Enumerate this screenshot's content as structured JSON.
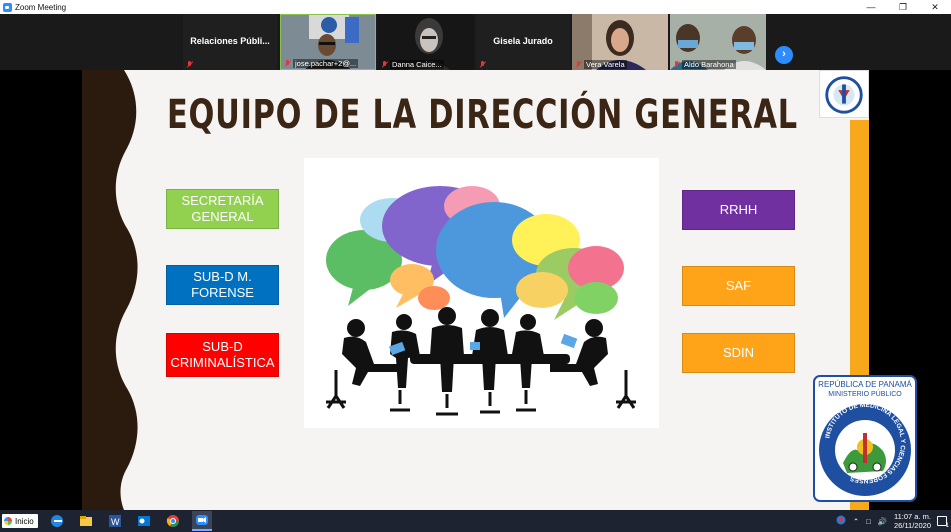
{
  "window": {
    "title": "Zoom Meeting"
  },
  "participants": [
    {
      "name": "Relaciones  Públi...",
      "video": false
    },
    {
      "name": "jose.pachar+2@...",
      "video": true
    },
    {
      "name": "Danna Caice...",
      "video": true
    },
    {
      "name": "Gisela Jurado",
      "video": false
    },
    {
      "name": "Vera Varela",
      "video": true
    },
    {
      "name": "Aldo Barahona",
      "video": true
    }
  ],
  "slide": {
    "title": "EQUIPO DE LA DIRECCIÓN GENERAL",
    "left_boxes": [
      {
        "line1": "SECRETARÍA",
        "line2": "GENERAL",
        "color": "#92d050"
      },
      {
        "line1": "SUB-D M.",
        "line2": "FORENSE",
        "color": "#0070c0"
      },
      {
        "line1": "SUB-D",
        "line2": "CRIMINALÍSTICA",
        "color": "#ff0000"
      }
    ],
    "right_boxes": [
      {
        "label": "RRHH",
        "color": "#7030a0"
      },
      {
        "label": "SAF",
        "color": "#ffa318"
      },
      {
        "label": "SDIN",
        "color": "#ffa318"
      }
    ],
    "seal": {
      "top_line1": "REPÚBLICA DE PANAMÁ",
      "top_line2": "MINISTERIO PÚBLICO",
      "ring_text": "INSTITUTO DE MEDICINA LEGAL Y CIENCIAS FORENSES"
    }
  },
  "taskbar": {
    "start_label": "Inicio",
    "time": "11:07 a. m.",
    "date": "26/11/2020"
  },
  "colors": {
    "accent": "#2d8cff",
    "slide_brown": "#2b1a0e",
    "slide_gold": "#f7a81b"
  }
}
